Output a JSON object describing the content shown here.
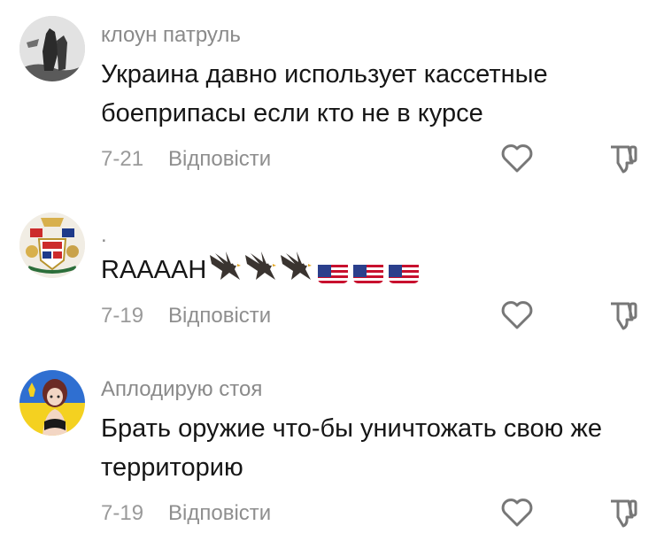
{
  "comments": [
    {
      "username": "клоун патруль",
      "text": "Украина давно использует кассетные боеприпасы если кто не в курсе",
      "date": "7-21",
      "reply_label": "Відповісти"
    },
    {
      "username": ".",
      "text": "RAAAAH",
      "date": "7-19",
      "reply_label": "Відповісти"
    },
    {
      "username": "Аплодирую стоя",
      "text": "Брать оружие что-бы уничтожать свою же территорию",
      "date": "7-19",
      "reply_label": "Відповісти"
    }
  ]
}
